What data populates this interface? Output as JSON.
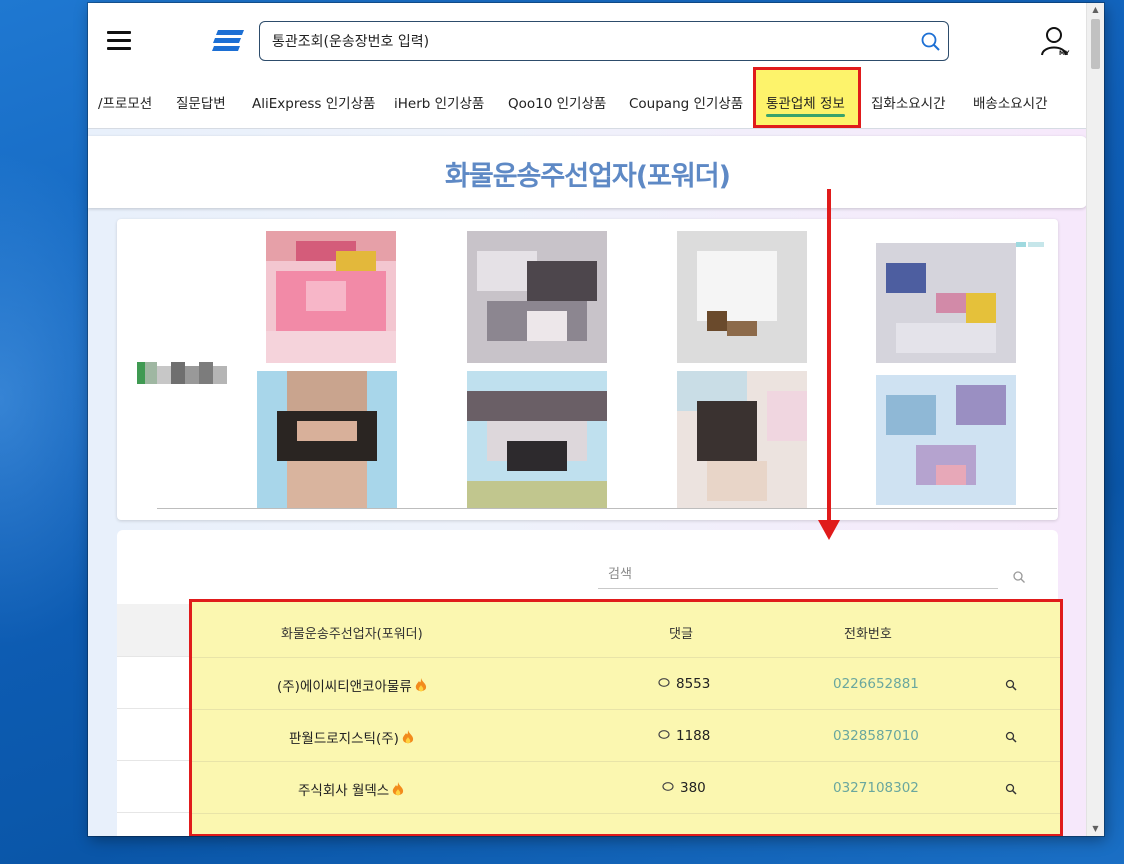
{
  "header": {
    "search_placeholder": "통관조회(운송장번호 입력)"
  },
  "nav": {
    "items": [
      {
        "label": "/프로모션"
      },
      {
        "label": "질문답변"
      },
      {
        "label": "AliExpress 인기상품"
      },
      {
        "label": "iHerb 인기상품"
      },
      {
        "label": "Qoo10 인기상품"
      },
      {
        "label": "Coupang 인기상품"
      },
      {
        "label": "통관업체 정보"
      },
      {
        "label": "집화소요시간"
      },
      {
        "label": "배송소요시간"
      }
    ],
    "active": "통관업체 정보"
  },
  "page_title": "화물운송주선업자(포워더)",
  "list": {
    "search_placeholder": "검색",
    "columns": {
      "name": "화물운송주선업자(포워더)",
      "comments": "댓글",
      "phone": "전화번호"
    },
    "rows": [
      {
        "name": "(주)에이씨티앤코아물류",
        "hot": true,
        "comments": "8553",
        "phone": "0226652881"
      },
      {
        "name": "판월드로지스틱(주)",
        "hot": true,
        "comments": "1188",
        "phone": "0328587010"
      },
      {
        "name": "주식회사 월덱스",
        "hot": true,
        "comments": "380",
        "phone": "0327108302"
      }
    ]
  },
  "colors": {
    "accent_title": "#5e89c5",
    "annotation_red": "#e01b1b",
    "highlight_yellow": "#fdf36b",
    "phone_teal": "#6aa79e",
    "nav_underline": "#39a36b"
  },
  "icons": [
    "hamburger-icon",
    "logo-icon",
    "search-icon",
    "user-my-icon",
    "comment-icon",
    "fire-icon",
    "down-arrow-annotation"
  ]
}
